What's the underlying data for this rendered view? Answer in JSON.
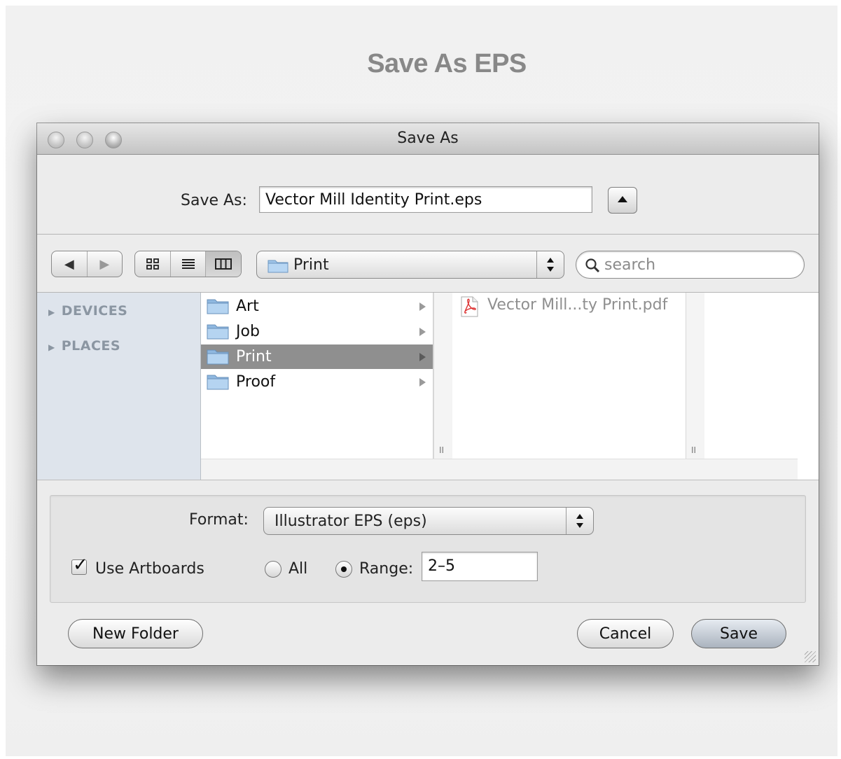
{
  "page": {
    "heading": "Save As EPS"
  },
  "window": {
    "title": "Save As"
  },
  "save_as": {
    "label": "Save As:",
    "filename": "Vector Mill Identity Print.eps",
    "expand_icon": "disclosure-up-icon"
  },
  "toolbar": {
    "back_icon": "◀",
    "forward_icon": "▶",
    "icon_view": "☷",
    "list_view": "≡",
    "column_view": "▥",
    "location": "Print",
    "search_placeholder": "search"
  },
  "sidebar": {
    "sections": [
      {
        "label": "DEVICES"
      },
      {
        "label": "PLACES"
      }
    ]
  },
  "browser": {
    "column1": [
      {
        "label": "Art",
        "selected": false
      },
      {
        "label": "Job",
        "selected": false
      },
      {
        "label": "Print",
        "selected": true
      },
      {
        "label": "Proof",
        "selected": false
      }
    ],
    "column2": [
      {
        "label": "Vector Mill...ty Print.pdf"
      }
    ],
    "handle": "II"
  },
  "options": {
    "format_label": "Format:",
    "format_value": "Illustrator EPS (eps)",
    "use_artboards_label": "Use Artboards",
    "use_artboards_checked": true,
    "all_label": "All",
    "range_label": "Range:",
    "range_value": "2–5",
    "selected_radio": "range"
  },
  "buttons": {
    "new_folder": "New Folder",
    "cancel": "Cancel",
    "save": "Save"
  },
  "colors": {
    "selection": "#8f8f8f",
    "sidebar": "#dee4ec",
    "default_button": "#aab3be"
  }
}
